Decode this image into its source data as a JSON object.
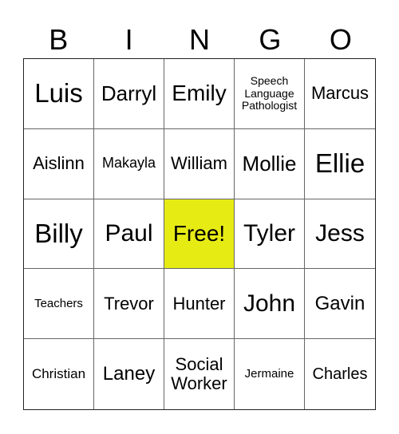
{
  "header": [
    "B",
    "I",
    "N",
    "G",
    "O"
  ],
  "free_color": "#e6eb14",
  "cells": [
    "Luis",
    "Darryl",
    "Emily",
    "Speech Language Pathologist",
    "Marcus",
    "Aislinn",
    "Makayla",
    "William",
    "Mollie",
    "Ellie",
    "Billy",
    "Paul",
    "Free!",
    "Tyler",
    "Jess",
    "Teachers",
    "Trevor",
    "Hunter",
    "John",
    "Gavin",
    "Christian",
    "Laney",
    "Social Worker",
    "Jermaine",
    "Charles"
  ]
}
